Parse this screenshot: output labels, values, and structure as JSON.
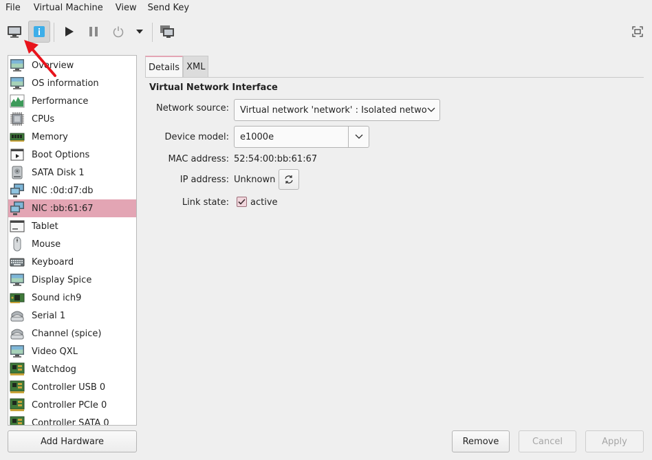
{
  "menu": [
    "File",
    "Virtual Machine",
    "View",
    "Send Key"
  ],
  "toolbar": {
    "console": "console-icon",
    "details": "info-icon",
    "run": "play-icon",
    "pause": "pause-icon",
    "shutdown": "power-icon",
    "shutdown_menu": "chevron-down-icon",
    "snapshots": "snapshots-icon",
    "fullscreen": "fullscreen-icon"
  },
  "hardware": [
    {
      "label": "Overview",
      "icon": "monitor-icon"
    },
    {
      "label": "OS information",
      "icon": "monitor-icon"
    },
    {
      "label": "Performance",
      "icon": "chart-icon"
    },
    {
      "label": "CPUs",
      "icon": "cpu-icon"
    },
    {
      "label": "Memory",
      "icon": "memory-icon"
    },
    {
      "label": "Boot Options",
      "icon": "boot-icon"
    },
    {
      "label": "SATA Disk 1",
      "icon": "disk-icon"
    },
    {
      "label": "NIC :0d:d7:db",
      "icon": "network-icon"
    },
    {
      "label": "NIC :bb:61:67",
      "icon": "network-icon",
      "selected": true
    },
    {
      "label": "Tablet",
      "icon": "tablet-icon"
    },
    {
      "label": "Mouse",
      "icon": "mouse-icon"
    },
    {
      "label": "Keyboard",
      "icon": "keyboard-icon"
    },
    {
      "label": "Display Spice",
      "icon": "display-icon"
    },
    {
      "label": "Sound ich9",
      "icon": "sound-card-icon"
    },
    {
      "label": "Serial 1",
      "icon": "serial-icon"
    },
    {
      "label": "Channel (spice)",
      "icon": "serial-icon"
    },
    {
      "label": "Video QXL",
      "icon": "display-icon"
    },
    {
      "label": "Watchdog",
      "icon": "pci-card-icon"
    },
    {
      "label": "Controller USB 0",
      "icon": "pci-card-icon"
    },
    {
      "label": "Controller PCIe 0",
      "icon": "pci-card-icon"
    },
    {
      "label": "Controller SATA 0",
      "icon": "pci-card-icon"
    }
  ],
  "buttons": {
    "add_hardware": "Add Hardware",
    "remove": "Remove",
    "cancel": "Cancel",
    "apply": "Apply"
  },
  "tabs": {
    "details": "Details",
    "xml": "XML"
  },
  "details": {
    "title": "Virtual Network Interface",
    "network_source_label": "Network source:",
    "network_source_value": "Virtual network 'network' : Isolated network",
    "device_model_label": "Device model:",
    "device_model_value": "e1000e",
    "mac_label": "MAC address:",
    "mac_value": "52:54:00:bb:61:67",
    "ip_label": "IP address:",
    "ip_value": "Unknown",
    "link_label": "Link state:",
    "link_value": "active",
    "link_checked": true
  },
  "colors": {
    "selection": "#e3a5b4",
    "annotation_arrow": "#e8141c",
    "info_blue": "#3daee9"
  }
}
